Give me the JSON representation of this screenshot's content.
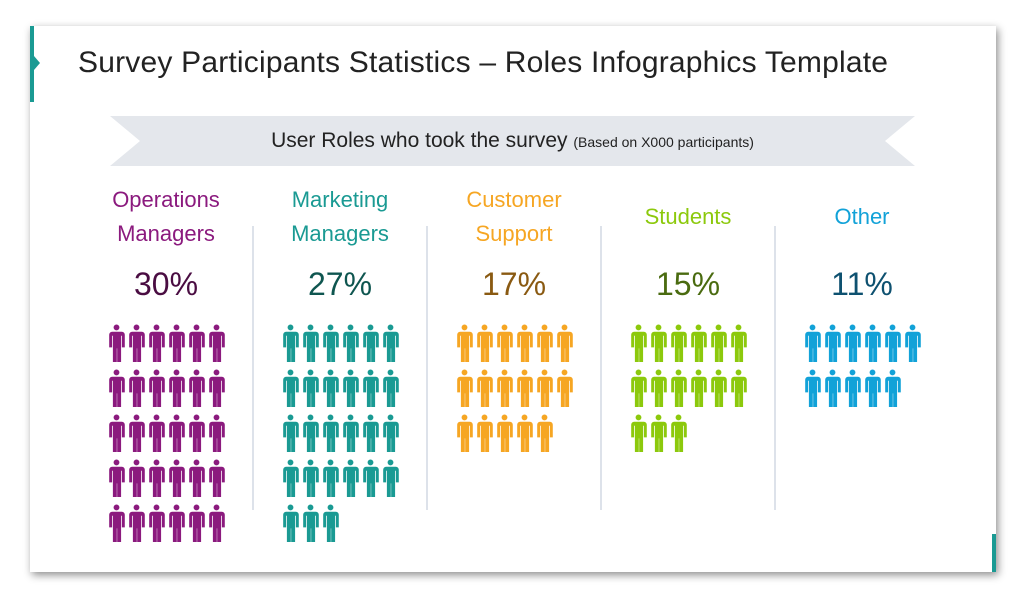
{
  "title": "Survey Participants Statistics – Roles Infographics Template",
  "banner": {
    "main": "User Roles who took the survey",
    "sub": "(Based on X000 participants)"
  },
  "chart_data": {
    "type": "pictograph",
    "title": "User Roles who took the survey",
    "subtitle": "(Based on X000 participants)",
    "unit": "1 icon = 1%",
    "categories": [
      {
        "label_lines": [
          "Operations",
          "Managers"
        ],
        "value": 30,
        "display": "30%",
        "color": "#8b1a7e",
        "pct_color": "#4a0d42"
      },
      {
        "label_lines": [
          "Marketing",
          "Managers"
        ],
        "value": 27,
        "display": "27%",
        "color": "#1a9a93",
        "pct_color": "#0f5650"
      },
      {
        "label_lines": [
          "Customer",
          "Support"
        ],
        "value": 17,
        "display": "17%",
        "color": "#f6a623",
        "pct_color": "#8a5a12"
      },
      {
        "label_lines": [
          "Students"
        ],
        "value": 15,
        "display": "15%",
        "color": "#8cc90c",
        "pct_color": "#4a6b10"
      },
      {
        "label_lines": [
          "Other"
        ],
        "value": 11,
        "display": "11%",
        "color": "#12a2d8",
        "pct_color": "#0e5170"
      }
    ]
  }
}
